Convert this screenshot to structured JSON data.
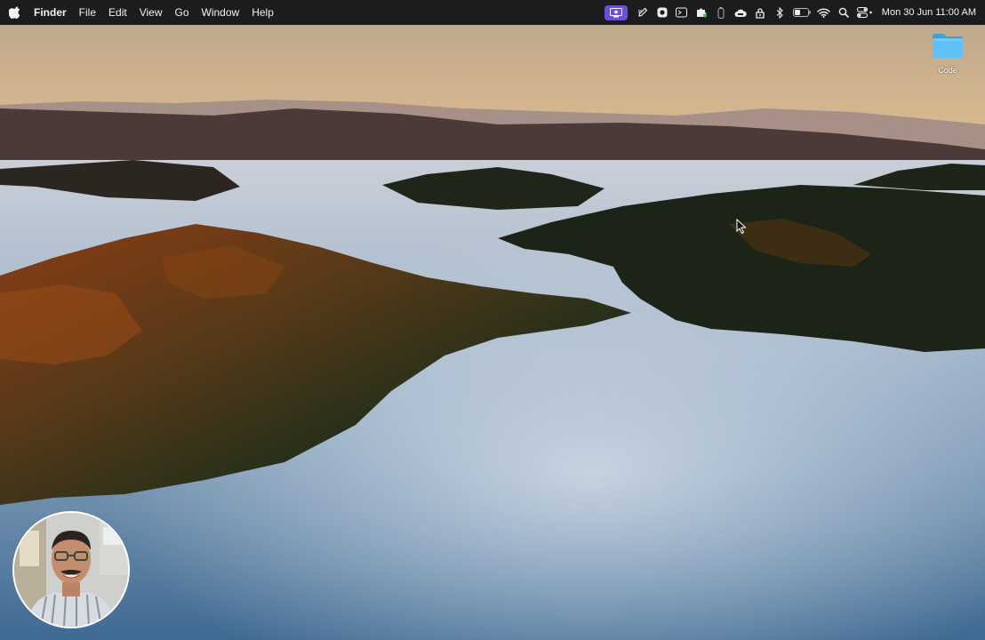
{
  "menubar": {
    "app_name": "Finder",
    "menus": [
      "File",
      "Edit",
      "View",
      "Go",
      "Window",
      "Help"
    ],
    "status_icons": [
      "screen-recorder-icon",
      "pen-icon",
      "record-icon",
      "window-icon",
      "extension-icon",
      "battery-indicator-icon",
      "cloud-icon",
      "privacy-icon",
      "bluetooth-icon",
      "battery-icon",
      "wifi-icon",
      "spotlight-search-icon",
      "control-center-icon"
    ],
    "clock": "Mon 30 Jun  11:00 AM"
  },
  "desktop": {
    "icons": [
      {
        "label": "Code",
        "icon": "folder-icon"
      }
    ]
  },
  "colors": {
    "menubar_bg": "#1c1c1e",
    "accent": "#6b4fd6",
    "folder_blue": "#4bb6ef"
  }
}
